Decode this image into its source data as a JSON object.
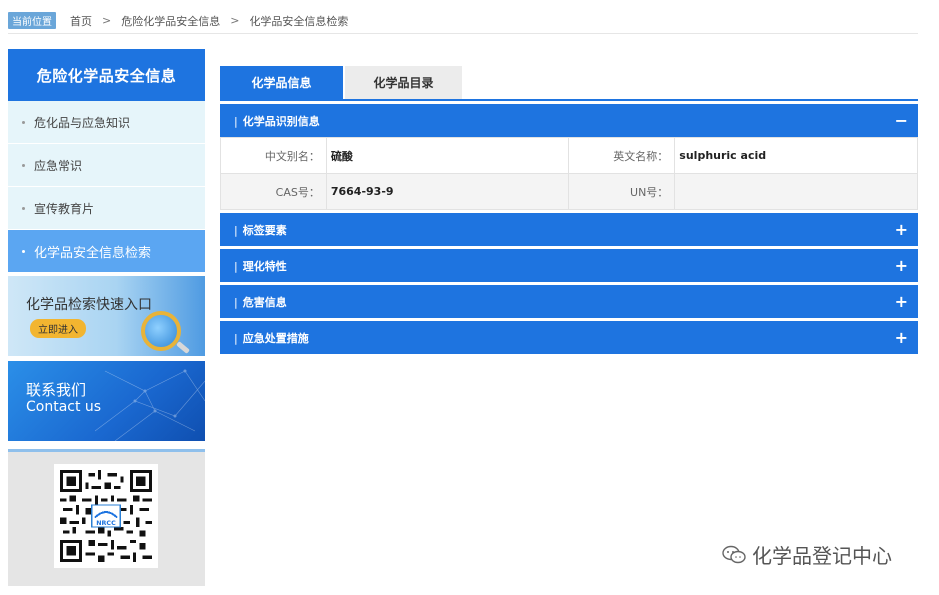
{
  "breadcrumb": {
    "badge": "当前位置",
    "items": [
      "首页",
      "危险化学品安全信息",
      "化学品安全信息检索"
    ],
    "separator": ">"
  },
  "sidebar": {
    "title": "危险化学品安全信息",
    "items": [
      {
        "label": "危化品与应急知识",
        "active": false
      },
      {
        "label": "应急常识",
        "active": false
      },
      {
        "label": "宣传教育片",
        "active": false
      },
      {
        "label": "化学品安全信息检索",
        "active": true
      }
    ],
    "quick_entry": {
      "title": "化学品检索快速入口",
      "button": "立即进入"
    },
    "contact": {
      "title_cn": "联系我们",
      "title_en": "Contact us"
    },
    "qr_logo": "NRCC"
  },
  "tabs": [
    {
      "label": "化学品信息",
      "active": true
    },
    {
      "label": "化学品目录",
      "active": false
    }
  ],
  "sections": [
    {
      "title": "化学品识别信息",
      "expanded": true,
      "toggle": "−",
      "rows": [
        {
          "label1": "中文别名：",
          "value1": "硫酸",
          "label2": "英文名称：",
          "value2": "sulphuric acid"
        },
        {
          "label1": "CAS号：",
          "value1": "7664-93-9",
          "label2": "UN号：",
          "value2": ""
        }
      ]
    },
    {
      "title": "标签要素",
      "expanded": false,
      "toggle": "+"
    },
    {
      "title": "理化特性",
      "expanded": false,
      "toggle": "+"
    },
    {
      "title": "危害信息",
      "expanded": false,
      "toggle": "+"
    },
    {
      "title": "应急处置措施",
      "expanded": false,
      "toggle": "+"
    }
  ],
  "watermark": {
    "text": "化学品登记中心"
  },
  "colors": {
    "primary": "#1e74e0",
    "active_menu": "#5ba6f2",
    "menu_bg": "#e6f5fa"
  }
}
